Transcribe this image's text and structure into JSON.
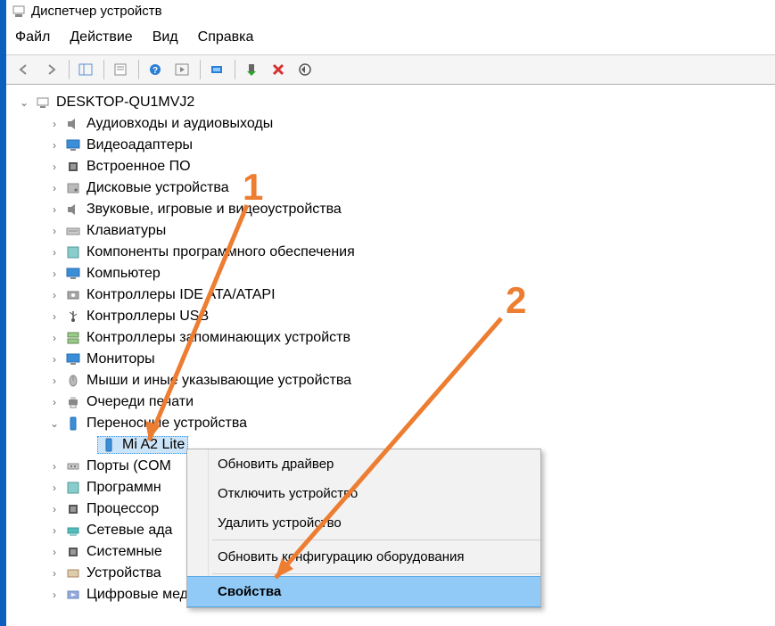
{
  "window": {
    "title": "Диспетчер устройств"
  },
  "menu": {
    "file": "Файл",
    "action": "Действие",
    "view": "Вид",
    "help": "Справка"
  },
  "tree": {
    "root": "DESKTOP-QU1MVJ2",
    "nodes": {
      "audio_io": "Аудиовходы и аудиовыходы",
      "video_adapters": "Видеоадаптеры",
      "firmware": "Встроенное ПО",
      "disk_drives": "Дисковые устройства",
      "sound_game": "Звуковые, игровые и видеоустройства",
      "keyboards": "Клавиатуры",
      "software_components": "Компоненты программного обеспечения",
      "computer": "Компьютер",
      "ide_atapi": "Контроллеры IDE ATA/ATAPI",
      "usb_controllers": "Контроллеры USB",
      "storage_controllers": "Контроллеры запоминающих устройств",
      "monitors": "Мониторы",
      "mice": "Мыши и иные указывающие устройства",
      "print_queues": "Очереди печати",
      "portable": "Переносные устройства",
      "portable_child": "Mi A2 Lite",
      "ports": "Порты (COM",
      "software_devices": "Программн",
      "processors": "Процессор",
      "network_adapters": "Сетевые ада",
      "system_devices": "Системные",
      "hid": "Устройства",
      "digital_media": "Цифровые медиаустройства"
    }
  },
  "context_menu": {
    "update_driver": "Обновить драйвер",
    "disable_device": "Отключить устройство",
    "remove_device": "Удалить устройство",
    "scan_hardware": "Обновить конфигурацию оборудования",
    "properties": "Свойства"
  },
  "annotations": {
    "n1": "1",
    "n2": "2"
  }
}
